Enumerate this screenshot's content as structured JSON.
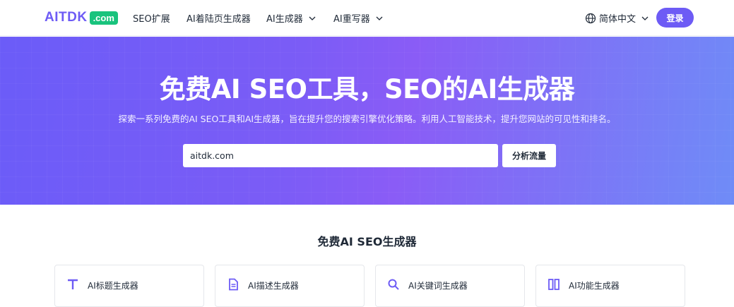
{
  "nav": {
    "logo_text": "AITDK",
    "logo_badge": ".com",
    "items": [
      {
        "label": "SEO扩展"
      },
      {
        "label": "AI着陆页生成器"
      },
      {
        "label": "AI生成器"
      },
      {
        "label": "AI重写器"
      }
    ],
    "language": "简体中文",
    "login": "登录"
  },
  "hero": {
    "title": "免费AI SEO工具，SEO的AI生成器",
    "subtitle": "探索一系列免费的AI SEO工具和AI生成器，旨在提升您的搜索引擎优化策略。利用人工智能技术，提升您网站的可见性和排名。",
    "search_value": "aitdk.com",
    "analyze_button": "分析流量"
  },
  "section": {
    "title": "免费AI SEO生成器",
    "cards": [
      {
        "label": "AI标题生成器",
        "icon": "text-t-icon"
      },
      {
        "label": "AI描述生成器",
        "icon": "document-icon"
      },
      {
        "label": "AI关键词生成器",
        "icon": "search-icon"
      },
      {
        "label": "AI功能生成器",
        "icon": "grid-icon"
      }
    ]
  },
  "colors": {
    "brand": "#6d5bf5",
    "badge": "#19c37d"
  }
}
